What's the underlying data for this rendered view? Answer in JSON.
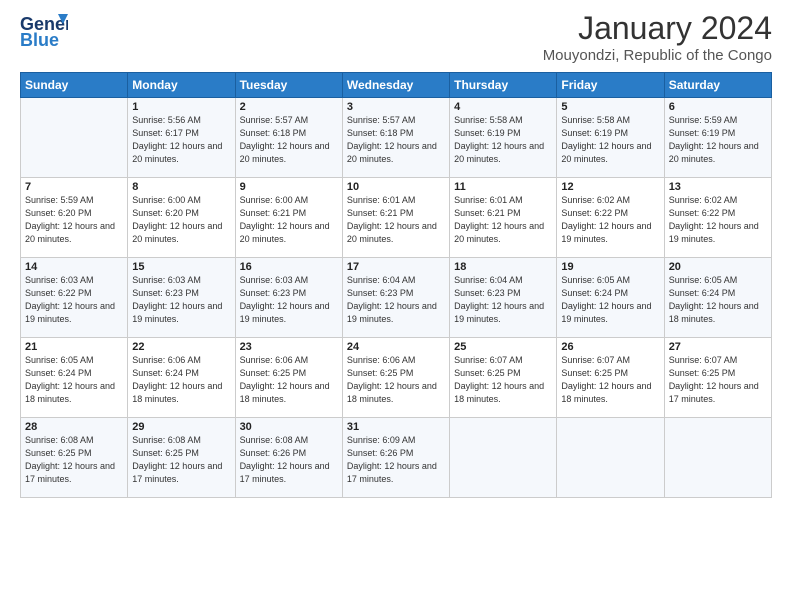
{
  "logo": {
    "part1": "General",
    "part2": "Blue"
  },
  "title": "January 2024",
  "subtitle": "Mouyondzi, Republic of the Congo",
  "days_of_week": [
    "Sunday",
    "Monday",
    "Tuesday",
    "Wednesday",
    "Thursday",
    "Friday",
    "Saturday"
  ],
  "weeks": [
    [
      {
        "day": "",
        "sunrise": "",
        "sunset": "",
        "daylight": ""
      },
      {
        "day": "1",
        "sunrise": "Sunrise: 5:56 AM",
        "sunset": "Sunset: 6:17 PM",
        "daylight": "Daylight: 12 hours and 20 minutes."
      },
      {
        "day": "2",
        "sunrise": "Sunrise: 5:57 AM",
        "sunset": "Sunset: 6:18 PM",
        "daylight": "Daylight: 12 hours and 20 minutes."
      },
      {
        "day": "3",
        "sunrise": "Sunrise: 5:57 AM",
        "sunset": "Sunset: 6:18 PM",
        "daylight": "Daylight: 12 hours and 20 minutes."
      },
      {
        "day": "4",
        "sunrise": "Sunrise: 5:58 AM",
        "sunset": "Sunset: 6:19 PM",
        "daylight": "Daylight: 12 hours and 20 minutes."
      },
      {
        "day": "5",
        "sunrise": "Sunrise: 5:58 AM",
        "sunset": "Sunset: 6:19 PM",
        "daylight": "Daylight: 12 hours and 20 minutes."
      },
      {
        "day": "6",
        "sunrise": "Sunrise: 5:59 AM",
        "sunset": "Sunset: 6:19 PM",
        "daylight": "Daylight: 12 hours and 20 minutes."
      }
    ],
    [
      {
        "day": "7",
        "sunrise": "Sunrise: 5:59 AM",
        "sunset": "Sunset: 6:20 PM",
        "daylight": "Daylight: 12 hours and 20 minutes."
      },
      {
        "day": "8",
        "sunrise": "Sunrise: 6:00 AM",
        "sunset": "Sunset: 6:20 PM",
        "daylight": "Daylight: 12 hours and 20 minutes."
      },
      {
        "day": "9",
        "sunrise": "Sunrise: 6:00 AM",
        "sunset": "Sunset: 6:21 PM",
        "daylight": "Daylight: 12 hours and 20 minutes."
      },
      {
        "day": "10",
        "sunrise": "Sunrise: 6:01 AM",
        "sunset": "Sunset: 6:21 PM",
        "daylight": "Daylight: 12 hours and 20 minutes."
      },
      {
        "day": "11",
        "sunrise": "Sunrise: 6:01 AM",
        "sunset": "Sunset: 6:21 PM",
        "daylight": "Daylight: 12 hours and 20 minutes."
      },
      {
        "day": "12",
        "sunrise": "Sunrise: 6:02 AM",
        "sunset": "Sunset: 6:22 PM",
        "daylight": "Daylight: 12 hours and 19 minutes."
      },
      {
        "day": "13",
        "sunrise": "Sunrise: 6:02 AM",
        "sunset": "Sunset: 6:22 PM",
        "daylight": "Daylight: 12 hours and 19 minutes."
      }
    ],
    [
      {
        "day": "14",
        "sunrise": "Sunrise: 6:03 AM",
        "sunset": "Sunset: 6:22 PM",
        "daylight": "Daylight: 12 hours and 19 minutes."
      },
      {
        "day": "15",
        "sunrise": "Sunrise: 6:03 AM",
        "sunset": "Sunset: 6:23 PM",
        "daylight": "Daylight: 12 hours and 19 minutes."
      },
      {
        "day": "16",
        "sunrise": "Sunrise: 6:03 AM",
        "sunset": "Sunset: 6:23 PM",
        "daylight": "Daylight: 12 hours and 19 minutes."
      },
      {
        "day": "17",
        "sunrise": "Sunrise: 6:04 AM",
        "sunset": "Sunset: 6:23 PM",
        "daylight": "Daylight: 12 hours and 19 minutes."
      },
      {
        "day": "18",
        "sunrise": "Sunrise: 6:04 AM",
        "sunset": "Sunset: 6:23 PM",
        "daylight": "Daylight: 12 hours and 19 minutes."
      },
      {
        "day": "19",
        "sunrise": "Sunrise: 6:05 AM",
        "sunset": "Sunset: 6:24 PM",
        "daylight": "Daylight: 12 hours and 19 minutes."
      },
      {
        "day": "20",
        "sunrise": "Sunrise: 6:05 AM",
        "sunset": "Sunset: 6:24 PM",
        "daylight": "Daylight: 12 hours and 18 minutes."
      }
    ],
    [
      {
        "day": "21",
        "sunrise": "Sunrise: 6:05 AM",
        "sunset": "Sunset: 6:24 PM",
        "daylight": "Daylight: 12 hours and 18 minutes."
      },
      {
        "day": "22",
        "sunrise": "Sunrise: 6:06 AM",
        "sunset": "Sunset: 6:24 PM",
        "daylight": "Daylight: 12 hours and 18 minutes."
      },
      {
        "day": "23",
        "sunrise": "Sunrise: 6:06 AM",
        "sunset": "Sunset: 6:25 PM",
        "daylight": "Daylight: 12 hours and 18 minutes."
      },
      {
        "day": "24",
        "sunrise": "Sunrise: 6:06 AM",
        "sunset": "Sunset: 6:25 PM",
        "daylight": "Daylight: 12 hours and 18 minutes."
      },
      {
        "day": "25",
        "sunrise": "Sunrise: 6:07 AM",
        "sunset": "Sunset: 6:25 PM",
        "daylight": "Daylight: 12 hours and 18 minutes."
      },
      {
        "day": "26",
        "sunrise": "Sunrise: 6:07 AM",
        "sunset": "Sunset: 6:25 PM",
        "daylight": "Daylight: 12 hours and 18 minutes."
      },
      {
        "day": "27",
        "sunrise": "Sunrise: 6:07 AM",
        "sunset": "Sunset: 6:25 PM",
        "daylight": "Daylight: 12 hours and 17 minutes."
      }
    ],
    [
      {
        "day": "28",
        "sunrise": "Sunrise: 6:08 AM",
        "sunset": "Sunset: 6:25 PM",
        "daylight": "Daylight: 12 hours and 17 minutes."
      },
      {
        "day": "29",
        "sunrise": "Sunrise: 6:08 AM",
        "sunset": "Sunset: 6:25 PM",
        "daylight": "Daylight: 12 hours and 17 minutes."
      },
      {
        "day": "30",
        "sunrise": "Sunrise: 6:08 AM",
        "sunset": "Sunset: 6:26 PM",
        "daylight": "Daylight: 12 hours and 17 minutes."
      },
      {
        "day": "31",
        "sunrise": "Sunrise: 6:09 AM",
        "sunset": "Sunset: 6:26 PM",
        "daylight": "Daylight: 12 hours and 17 minutes."
      },
      {
        "day": "",
        "sunrise": "",
        "sunset": "",
        "daylight": ""
      },
      {
        "day": "",
        "sunrise": "",
        "sunset": "",
        "daylight": ""
      },
      {
        "day": "",
        "sunrise": "",
        "sunset": "",
        "daylight": ""
      }
    ]
  ]
}
